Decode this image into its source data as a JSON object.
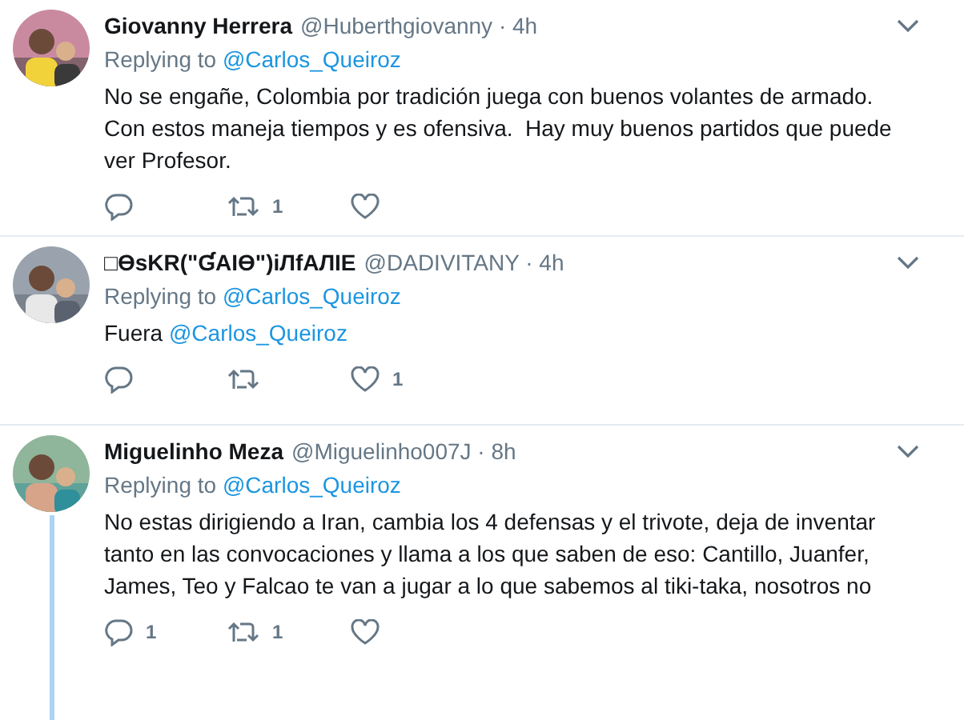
{
  "tweets": [
    {
      "name": "Giovanny Herrera",
      "meta": "@Huberthgiovanny · 4h",
      "replying_label": "Replying to",
      "reply_to": "@Carlos_Queiroz",
      "body": [
        {
          "kind": "text",
          "text": "No se engañe, Colombia por tradición juega con buenos volantes de armado. Con estos maneja tiempos y es ofensiva.  Hay muy buenos partidos que puede ver Profesor."
        }
      ],
      "retweet_count": "1",
      "thread_line": false
    },
    {
      "name": "□ƟsKR(\"ƓAIƟ\")iЛfAЛIE",
      "meta": "@DADIVITANY · 4h",
      "replying_label": "Replying to",
      "reply_to": "@Carlos_Queiroz",
      "body": [
        {
          "kind": "text",
          "text": "Fuera "
        },
        {
          "kind": "mention",
          "text": "@Carlos_Queiroz"
        }
      ],
      "like_count": "1",
      "thread_line": false
    },
    {
      "name": "Miguelinho Meza",
      "meta": "@Miguelinho007J · 8h",
      "replying_label": "Replying to",
      "reply_to": "@Carlos_Queiroz",
      "body": [
        {
          "kind": "text",
          "text": "No estas dirigiendo a Iran, cambia los 4 defensas y el trivote, deja de inventar tanto en las convocaciones y llama a los que saben de eso: Cantillo, Juanfer, James, Teo y Falcao te van a jugar a lo que sabemos al tiki-taka, nosotros no"
        }
      ],
      "reply_count": "1",
      "retweet_count": "1",
      "thread_line": true
    }
  ]
}
